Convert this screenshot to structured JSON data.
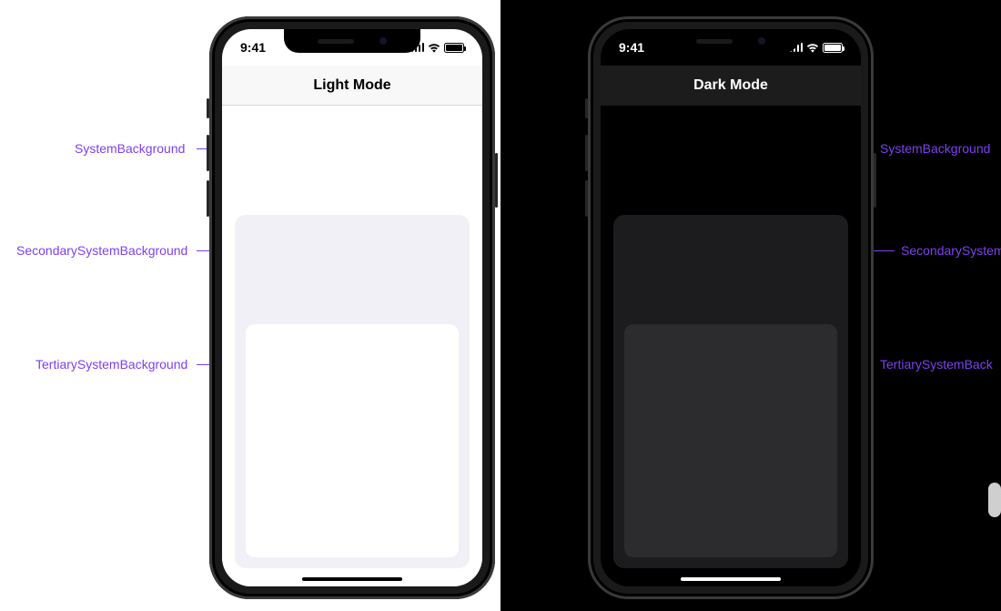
{
  "status": {
    "time": "9:41"
  },
  "light": {
    "title": "Light Mode",
    "labels": {
      "system": "SystemBackground",
      "secondary": "SecondarySystemBackground",
      "tertiary": "TertiarySystemBackground"
    },
    "colors": {
      "primary": "#ffffff",
      "secondary": "#f1f0f6",
      "tertiary": "#ffffff"
    }
  },
  "dark": {
    "title": "Dark Mode",
    "labels": {
      "system": "SystemBackground",
      "secondary": "SecondarySystemB",
      "tertiary": "TertiarySystemBack"
    },
    "colors": {
      "primary": "#000000",
      "secondary": "#1c1c1e",
      "tertiary": "#2c2c2e"
    }
  }
}
